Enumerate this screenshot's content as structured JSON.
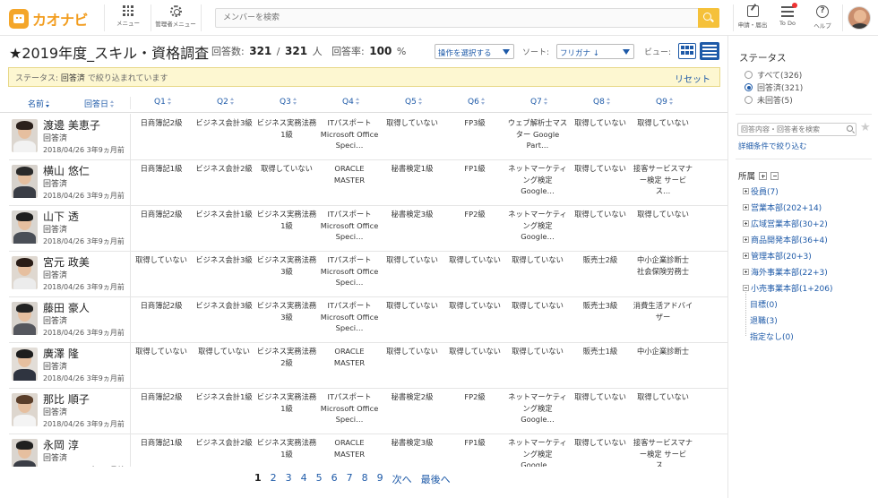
{
  "header": {
    "logo_text": "カオナビ",
    "menu_label": "メニュー",
    "admin_menu_label": "管理者メニュー",
    "search_placeholder": "メンバーを検索",
    "request_label": "申請・届出",
    "todo_label": "To Do",
    "help_label": "ヘルプ",
    "help_glyph": "?"
  },
  "survey": {
    "title": "★2019年度_スキル・資格調査",
    "responses_label": "回答数:",
    "responses_count": "321",
    "total_sep": "/",
    "total_count": "321",
    "people_unit": "人",
    "rate_label": "回答率:",
    "rate_value": "100",
    "rate_unit": "%"
  },
  "toolbar": {
    "operation_select": "操作を選択する",
    "sort_label": "ソート:",
    "sort_value": "フリガナ ↓",
    "view_label": "ビュー:"
  },
  "filter": {
    "prefix": "ステータス:",
    "value": "回答済",
    "suffix": "で絞り込まれています",
    "reset_label": "リセット"
  },
  "table": {
    "headers": {
      "name": "名前",
      "date": "回答日",
      "q1": "Q1",
      "q2": "Q2",
      "q3": "Q3",
      "q4": "Q4",
      "q5": "Q5",
      "q6": "Q6",
      "q7": "Q7",
      "q8": "Q8",
      "q9": "Q9"
    },
    "rows": [
      {
        "name": "渡邊 美恵子",
        "status": "回答済",
        "date": "2018/04/26 3年9ヵ月前",
        "answers": [
          "日商簿記2級",
          "ビジネス会計3級",
          "ビジネス実務法務1級",
          "ITパスポート Microsoft Office Speci…",
          "取得していない",
          "FP3級",
          "ウェブ解析士マスター Google Part…",
          "取得していない",
          "取得していない"
        ]
      },
      {
        "name": "横山 悠仁",
        "status": "回答済",
        "date": "2018/04/26 3年9ヵ月前",
        "answers": [
          "日商簿記1級",
          "ビジネス会計2級",
          "取得していない",
          "ORACLE MASTER",
          "秘書検定1級",
          "FP1級",
          "ネットマーケティング検定 Google…",
          "取得していない",
          "接客サービスマナー検定 サービス…"
        ]
      },
      {
        "name": "山下 透",
        "status": "回答済",
        "date": "2018/04/26 3年9ヵ月前",
        "answers": [
          "日商簿記2級",
          "ビジネス会計1級",
          "ビジネス実務法務1級",
          "ITパスポート Microsoft Office Speci…",
          "秘書検定3級",
          "FP2級",
          "ネットマーケティング検定 Google…",
          "取得していない",
          "取得していない"
        ]
      },
      {
        "name": "宮元 政美",
        "status": "回答済",
        "date": "2018/04/26 3年9ヵ月前",
        "answers": [
          "取得していない",
          "ビジネス会計3級",
          "ビジネス実務法務3級",
          "ITパスポート Microsoft Office Speci…",
          "取得していない",
          "取得していない",
          "取得していない",
          "販売士2級",
          "中小企業診断士 社会保険労務士"
        ]
      },
      {
        "name": "藤田 豪人",
        "status": "回答済",
        "date": "2018/04/26 3年9ヵ月前",
        "answers": [
          "日商簿記2級",
          "ビジネス会計3級",
          "ビジネス実務法務3級",
          "ITパスポート Microsoft Office Speci…",
          "取得していない",
          "取得していない",
          "取得していない",
          "販売士3級",
          "消費生活アドバイザー"
        ]
      },
      {
        "name": "廣澤 隆",
        "status": "回答済",
        "date": "2018/04/26 3年9ヵ月前",
        "answers": [
          "取得していない",
          "取得していない",
          "ビジネス実務法務2級",
          "ORACLE MASTER",
          "取得していない",
          "取得していない",
          "取得していない",
          "販売士1級",
          "中小企業診断士"
        ]
      },
      {
        "name": "那比 順子",
        "status": "回答済",
        "date": "2018/04/26 3年9ヵ月前",
        "answers": [
          "日商簿記2級",
          "ビジネス会計1級",
          "ビジネス実務法務1級",
          "ITパスポート Microsoft Office Speci…",
          "秘書検定2級",
          "FP2級",
          "ネットマーケティング検定 Google…",
          "取得していない",
          "取得していない"
        ]
      },
      {
        "name": "永岡 淳",
        "status": "回答済",
        "date": "2018/04/26 3年9ヵ月前",
        "answers": [
          "日商簿記1級",
          "ビジネス会計2級",
          "ビジネス実務法務1級",
          "ORACLE MASTER",
          "秘書検定3級",
          "FP1級",
          "ネットマーケティング検定 Google…",
          "取得していない",
          "接客サービスマナー検定 サービス…"
        ]
      }
    ]
  },
  "pagination": {
    "pages": [
      "1",
      "2",
      "3",
      "4",
      "5",
      "6",
      "7",
      "8",
      "9"
    ],
    "current": "1",
    "next_label": "次へ",
    "last_label": "最後へ"
  },
  "sidebar": {
    "status_title": "ステータス",
    "status_options": [
      {
        "label": "すべて(326)",
        "selected": false
      },
      {
        "label": "回答済(321)",
        "selected": true
      },
      {
        "label": "未回答(5)",
        "selected": false
      }
    ],
    "search_placeholder": "回答内容・回答者を検索",
    "advanced_link": "詳細条件で絞り込む",
    "org_title": "所属",
    "org_items": [
      {
        "label": "役員(7)",
        "expand": "plus"
      },
      {
        "label": "営業本部(202+14)",
        "expand": "plus"
      },
      {
        "label": "広域営業本部(30+2)",
        "expand": "plus"
      },
      {
        "label": "商品開発本部(36+4)",
        "expand": "plus"
      },
      {
        "label": "管理本部(20+3)",
        "expand": "plus"
      },
      {
        "label": "海外事業本部(22+3)",
        "expand": "plus"
      },
      {
        "label": "小売事業本部(1+206)",
        "expand": "minus"
      },
      {
        "label": "目標(0)",
        "expand": "none"
      },
      {
        "label": "退職(3)",
        "expand": "none"
      },
      {
        "label": "指定なし(0)",
        "expand": "none"
      }
    ]
  },
  "colors": {
    "accent": "#1e5aa8",
    "brand": "#f29d1f",
    "search_button": "#f5c13a",
    "filter_bg": "#fdf7d1"
  }
}
